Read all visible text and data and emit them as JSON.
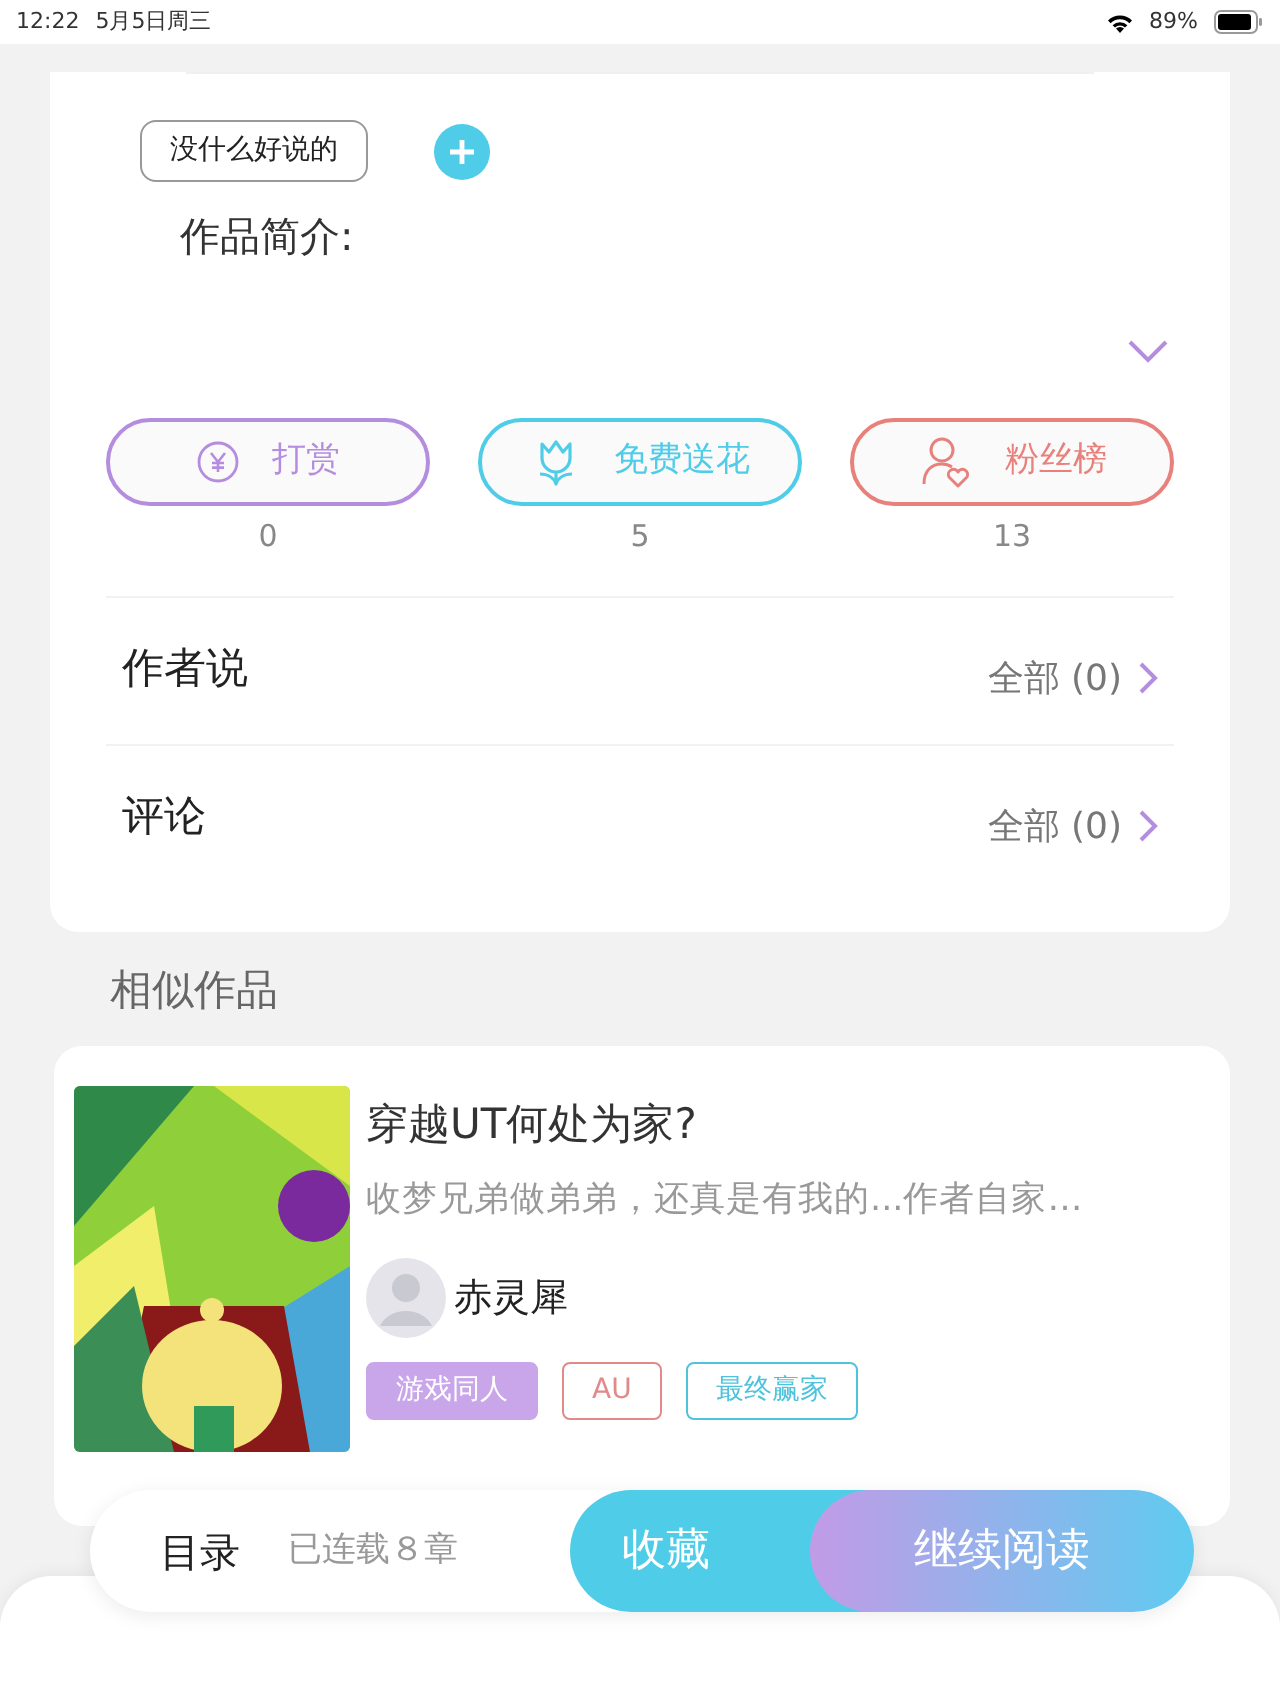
{
  "status_bar": {
    "time": "12:22",
    "date": "5月5日周三",
    "battery": "89%"
  },
  "tag_chip": {
    "label": "没什么好说的"
  },
  "intro": {
    "label": "作品简介:"
  },
  "actions": [
    {
      "kind": "reward",
      "label": "打赏",
      "count": "0",
      "color": "#b48ddf"
    },
    {
      "kind": "flower",
      "label": "免费送花",
      "count": "5",
      "color": "#4fcde8"
    },
    {
      "kind": "fans",
      "label": "粉丝榜",
      "count": "13",
      "color": "#e8817c"
    }
  ],
  "sections": [
    {
      "title": "作者说",
      "link": "全部 (0)"
    },
    {
      "title": "评论",
      "link": "全部 (0)"
    }
  ],
  "similar": {
    "heading": "相似作品",
    "book": {
      "title": "穿越UT何处为家?",
      "summary": "收梦兄弟做弟弟，还真是有我的...作者自家…",
      "author": "赤灵犀",
      "tags": [
        {
          "label": "游戏同人",
          "kind": "filled",
          "color": "#c9a6ea"
        },
        {
          "label": "AU",
          "kind": "outline",
          "color": "#e08a8a"
        },
        {
          "label": "最终赢家",
          "kind": "outline",
          "color": "#4fc3dc"
        }
      ]
    }
  },
  "bottom_bar": {
    "toc": "目录",
    "chapters": "已连载８章",
    "collect": "收藏",
    "read": "继续阅读"
  }
}
